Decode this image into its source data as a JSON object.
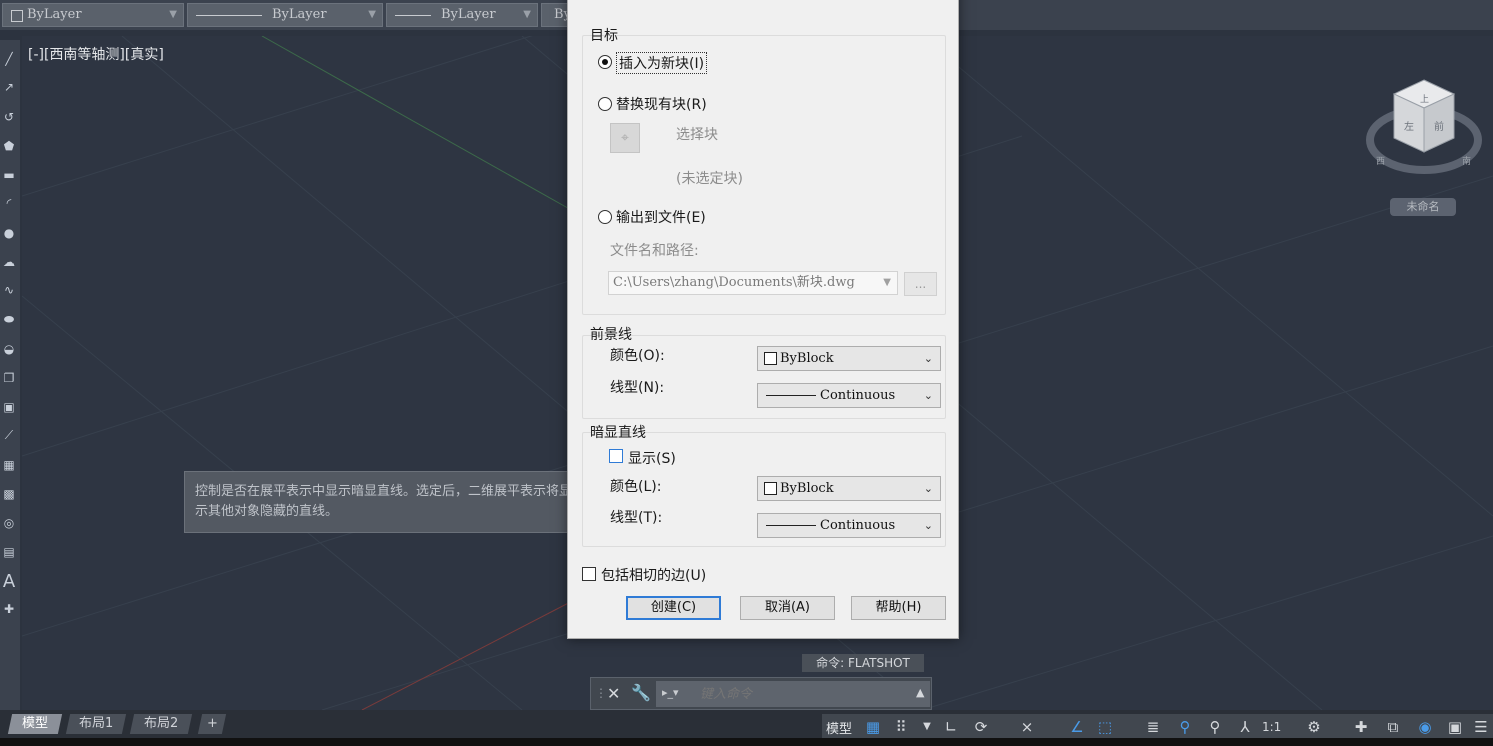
{
  "property_bar": {
    "color_value": "ByLayer",
    "linetype_value": "ByLayer",
    "lineweight_value": "ByLayer",
    "truncated_value": "By"
  },
  "viewport": {
    "label": "[-][西南等轴测][真实]",
    "cube_label": "未命名"
  },
  "tooltip": {
    "line1": "控制是否在展平表示中显示暗显直线。选定后，二维展平表示将显",
    "line2": "示其他对象隐藏的直线。"
  },
  "dialog": {
    "target_group": "目标",
    "radio_insert_new": "插入为新块(I)",
    "radio_replace": "替换现有块(R)",
    "select_block": "选择块",
    "no_block": "(未选定块)",
    "radio_export": "输出到文件(E)",
    "file_label": "文件名和路径:",
    "file_path": "C:\\Users\\zhang\\Documents\\新块.dwg",
    "browse": "...",
    "foreground_group": "前景线",
    "fg_color_label": "颜色(O):",
    "fg_color_value": "ByBlock",
    "fg_linetype_label": "线型(N):",
    "fg_linetype_value": "Continuous",
    "obscured_group": "暗显直线",
    "show_label": "显示(S)",
    "ob_color_label": "颜色(L):",
    "ob_color_value": "ByBlock",
    "ob_linetype_label": "线型(T):",
    "ob_linetype_value": "Continuous",
    "tangent_label": "包括相切的边(U)",
    "create_button": "创建(C)",
    "cancel_button": "取消(A)",
    "help_button": "帮助(H)"
  },
  "command": {
    "last_command": "命令: FLATSHOT",
    "input_placeholder": "键入命令"
  },
  "layout_tabs": [
    "模型",
    "布局1",
    "布局2",
    "+"
  ],
  "status": {
    "model_label": "模型",
    "scale_label": "1:1"
  }
}
